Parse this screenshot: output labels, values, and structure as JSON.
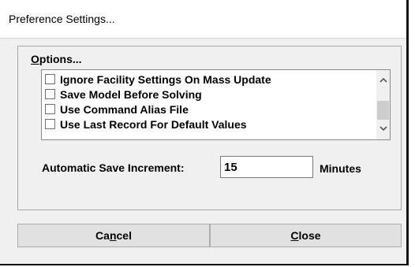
{
  "window": {
    "title": "Preference Settings..."
  },
  "options_group": {
    "label": "Options..."
  },
  "options_list": {
    "items": [
      {
        "label": "Ignore Facility Settings On Mass Update",
        "checked": false
      },
      {
        "label": "Save Model Before Solving",
        "checked": false
      },
      {
        "label": "Use Command Alias File",
        "checked": false
      },
      {
        "label": "Use Last Record For Default Values",
        "checked": false
      }
    ],
    "scroll_up_glyph": "⌃",
    "scroll_down_glyph": "⌄"
  },
  "autosave": {
    "label": "Automatic Save Increment:",
    "value": "15",
    "unit": "Minutes"
  },
  "buttons": {
    "cancel_label": "Cancel",
    "close_label": "Close"
  },
  "icons": {
    "scroll_up": "chevron-up-icon",
    "scroll_down": "chevron-down-icon",
    "checkbox": "checkbox-icon"
  }
}
